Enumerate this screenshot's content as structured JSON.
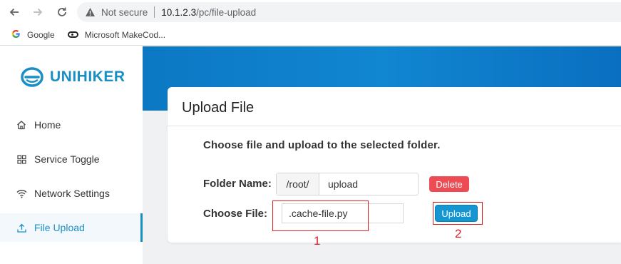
{
  "browser": {
    "nav_icons": [
      "arrow-left",
      "arrow-right",
      "reload"
    ],
    "security_label": "Not secure",
    "url_host": "10.1.2.3",
    "url_path": "/pc/file-upload",
    "bookmarks": [
      {
        "icon": "google-g",
        "label": "Google"
      },
      {
        "icon": "makecode",
        "label": "Microsoft MakeCod..."
      }
    ]
  },
  "app": {
    "brand": "UNIHIKER",
    "brand_color": "#1a8fc6",
    "accent_color": "#1596d1",
    "sidebar": {
      "items": [
        {
          "icon": "home",
          "label": "Home",
          "active": false
        },
        {
          "icon": "grid",
          "label": "Service Toggle",
          "active": false
        },
        {
          "icon": "wifi",
          "label": "Network Settings",
          "active": false
        },
        {
          "icon": "upload",
          "label": "File Upload",
          "active": true
        }
      ]
    },
    "card": {
      "title": "Upload File",
      "description": "Choose file and upload to the selected folder.",
      "folder_label": "Folder Name:",
      "folder_prefix": "/root/",
      "folder_value": "upload",
      "delete_label": "Delete",
      "delete_color": "#ee4c55",
      "file_label": "Choose File:",
      "file_value": ".cache-file.py",
      "upload_label": "Upload"
    }
  },
  "annotations": {
    "box1_label": "1",
    "box2_label": "2",
    "color": "#e02020"
  }
}
